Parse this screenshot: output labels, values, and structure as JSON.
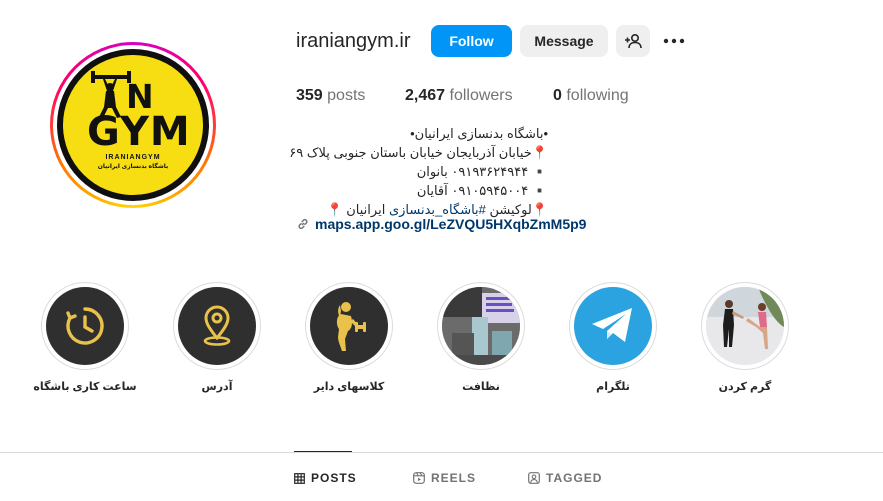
{
  "profile": {
    "username": "iraniangym.ir",
    "logo_text_n": "N",
    "logo_text_gym": "GYM",
    "logo_subtitle": "IRANIANGYM",
    "logo_subtitle_fa": "باشگاه بدنسازی ایرانیان"
  },
  "actions": {
    "follow_label": "Follow",
    "message_label": "Message"
  },
  "stats": {
    "posts_count": "359",
    "posts_label": "posts",
    "followers_count": "2,467",
    "followers_label": "followers",
    "following_count": "0",
    "following_label": "following"
  },
  "bio": {
    "line1": "•باشگاه بدنسازی ایرانیان•",
    "line2": "📍خیابان آذربایجان خیابان باستان جنوبی پلاک ۶۹",
    "line3": "▪️ ۰۹۱۹۳۶۲۴۹۴۴ بانوان",
    "line4": "▪️ ۰۹۱۰۵۹۴۵۰۰۴ آقایان",
    "line5_prefix": "📍لوکیشن ",
    "line5_hashtag": "#باشگاه_بدنسازی",
    "line5_suffix": " ایرانیان 📍",
    "link": "maps.app.goo.gl/LeZVQU5HXqbZmM5p9"
  },
  "highlights": [
    {
      "label": "ساعت کاری باشگاه",
      "icon": "clock-icon"
    },
    {
      "label": "آدرس",
      "icon": "location-pin-icon"
    },
    {
      "label": "کلاسهای دایر",
      "icon": "fitness-woman-icon"
    },
    {
      "label": "نظافت",
      "icon": "gym-equipment-photo"
    },
    {
      "label": "تلگرام",
      "icon": "telegram-icon"
    },
    {
      "label": "گرم کردن",
      "icon": "warmup-photo"
    }
  ],
  "tabs": {
    "posts": "POSTS",
    "reels": "REELS",
    "tagged": "TAGGED"
  },
  "colors": {
    "follow_blue": "#0095f6",
    "logo_yellow": "#f7de13",
    "link_blue": "#00376b",
    "highlight_dark": "#2f2f2f",
    "highlight_gold": "#e8c24a",
    "telegram_blue": "#2aa3e0"
  }
}
